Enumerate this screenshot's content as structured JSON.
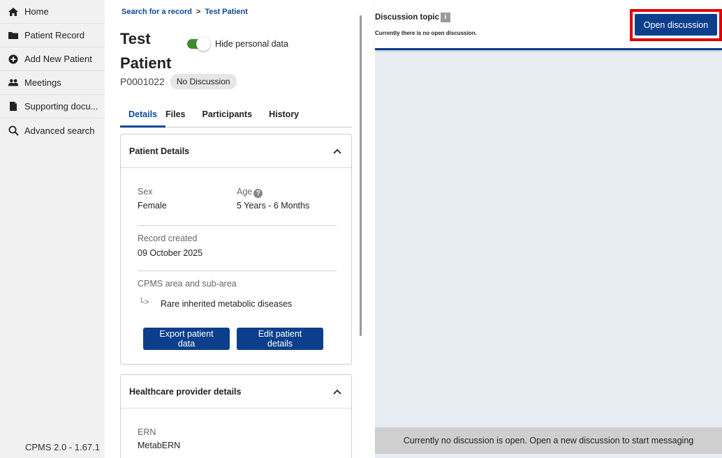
{
  "sidebar": {
    "items": [
      {
        "label": "Home",
        "icon": "home-icon"
      },
      {
        "label": "Patient Record",
        "icon": "folder-icon"
      },
      {
        "label": "Add New Patient",
        "icon": "plus-circle-icon"
      },
      {
        "label": "Meetings",
        "icon": "users-icon"
      },
      {
        "label": "Supporting docu...",
        "icon": "document-icon"
      },
      {
        "label": "Advanced search",
        "icon": "search-icon"
      }
    ],
    "version": "CPMS 2.0 - 1.67.1"
  },
  "breadcrumb": {
    "link": "Search for a record",
    "separator": ">",
    "current": "Test Patient"
  },
  "patient": {
    "name": "Test Patient",
    "id": "P0001022",
    "status_badge": "No Discussion"
  },
  "toggle": {
    "label": "Hide personal data",
    "on": true
  },
  "tabs": [
    {
      "label": "Details",
      "active": true
    },
    {
      "label": "Files",
      "active": false
    },
    {
      "label": "Participants",
      "active": false
    },
    {
      "label": "History",
      "active": false
    }
  ],
  "patient_details": {
    "title": "Patient Details",
    "sex_label": "Sex",
    "sex_value": "Female",
    "age_label": "Age",
    "age_value": "5 Years - 6 Months",
    "record_created_label": "Record created",
    "record_created_value": "09 October 2025",
    "area_label": "CPMS area and sub-area",
    "area_arrow": "└>",
    "area_value": "Rare inherited metabolic diseases",
    "export_button": "Export patient data",
    "edit_button": "Edit patient details"
  },
  "healthcare_provider": {
    "title": "Healthcare provider details",
    "ern_label": "ERN",
    "ern_value": "MetabERN"
  },
  "discussion": {
    "title": "Discussion topic",
    "info": "i",
    "subtitle": "Currently there is no open discussion.",
    "open_button": "Open discussion",
    "footer_message": "Currently no discussion is open. Open a new discussion to start messaging"
  },
  "colors": {
    "primary": "#0b3f8c",
    "link": "#0b4a97",
    "toggle_on": "#3e8e2f",
    "highlight": "#e00000"
  }
}
